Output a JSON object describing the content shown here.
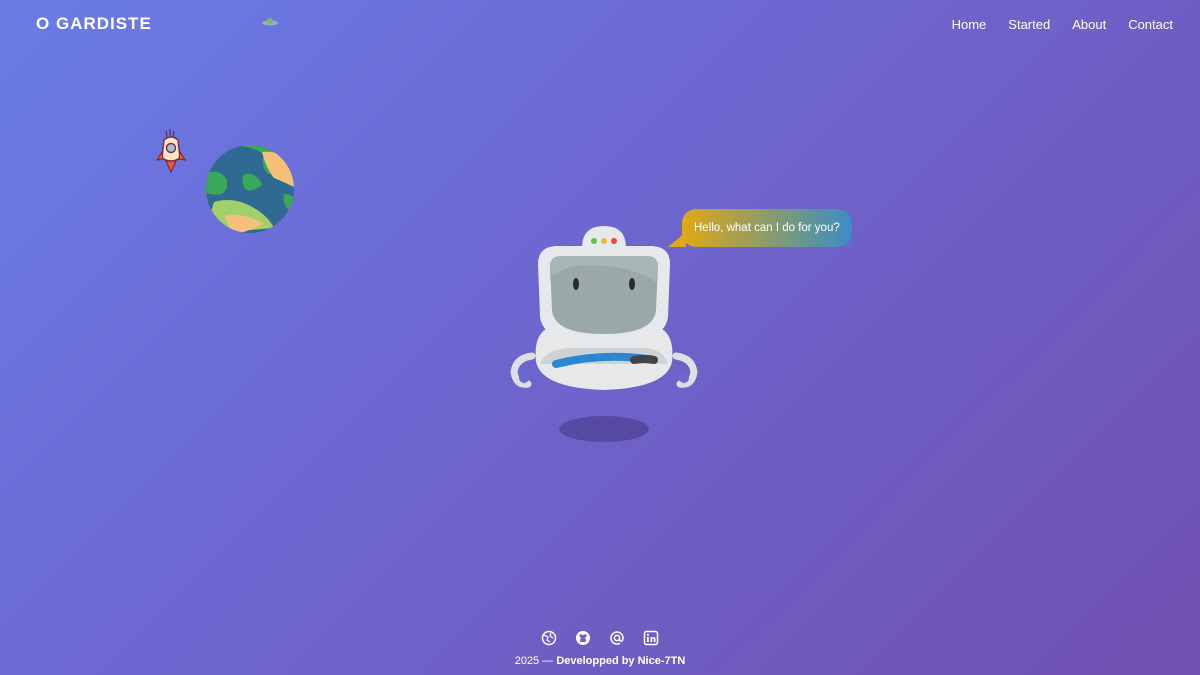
{
  "header": {
    "logo": "O GARDISTE",
    "nav": [
      "Home",
      "Started",
      "About",
      "Contact"
    ]
  },
  "chat": {
    "message": "Hello, what can I do for you?"
  },
  "footer": {
    "year": "2025",
    "separator": " — ",
    "credit": "Developped by Nice-7TN",
    "icons": [
      "globe-icon",
      "github-icon",
      "at-icon",
      "linkedin-icon"
    ]
  },
  "colors": {
    "bg_start": "#6a7de6",
    "bg_end": "#7050b0",
    "bubble_start": "#e0a816",
    "bubble_end": "#3a8cc8"
  }
}
